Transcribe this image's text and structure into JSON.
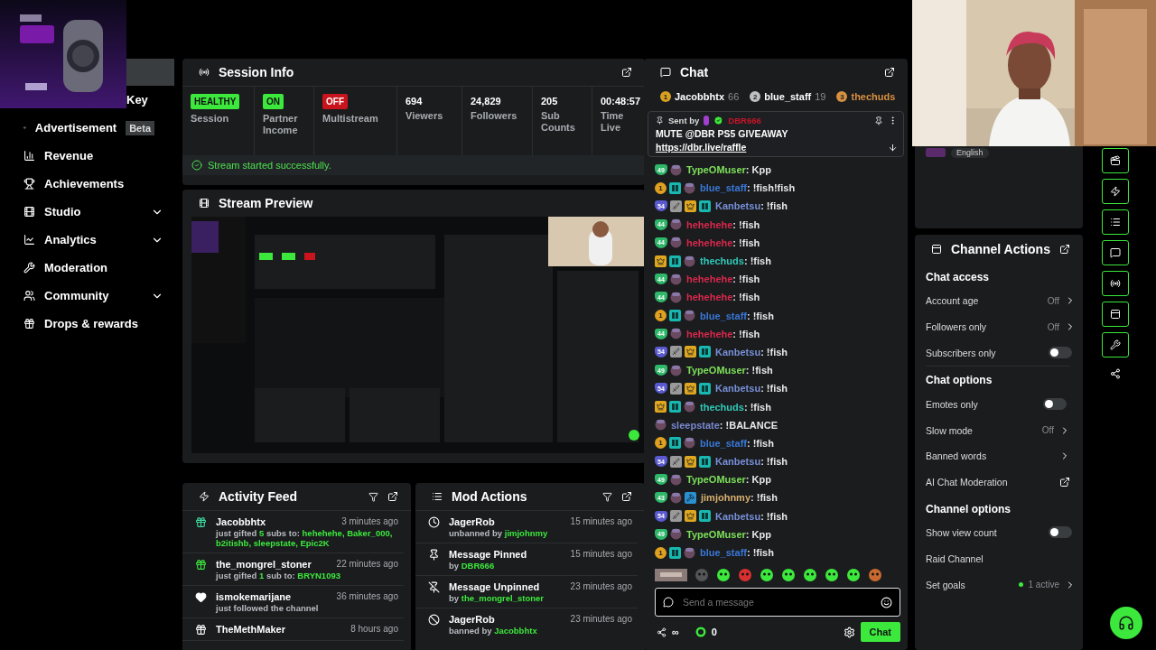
{
  "sidebar": {
    "items": [
      {
        "label": "Key",
        "kind": "partial"
      },
      {
        "label": "Advertisement",
        "badge": "Beta",
        "expandable": false
      },
      {
        "label": "Revenue",
        "expandable": false
      },
      {
        "label": "Achievements",
        "expandable": false
      },
      {
        "label": "Studio",
        "expandable": true
      },
      {
        "label": "Analytics",
        "expandable": true
      },
      {
        "label": "Moderation",
        "expandable": false
      },
      {
        "label": "Community",
        "expandable": true
      },
      {
        "label": "Drops & rewards",
        "expandable": false
      }
    ]
  },
  "session_info": {
    "title": "Session Info",
    "stats": [
      {
        "kind": "status",
        "pill": "HEALTHY",
        "color": "#3de83d",
        "label": "Session"
      },
      {
        "kind": "status",
        "pill": "ON",
        "color": "#3de83d",
        "label": "Partner Income"
      },
      {
        "kind": "status",
        "pill": "OFF",
        "color": "#c8141c",
        "label": "Multistream"
      },
      {
        "kind": "metric",
        "value": "694",
        "label": "Viewers"
      },
      {
        "kind": "metric",
        "value": "24,829",
        "label": "Followers"
      },
      {
        "kind": "metric",
        "value": "205",
        "label": "Sub Counts"
      },
      {
        "kind": "metric",
        "value": "00:48:57",
        "label": "Time Live"
      }
    ],
    "notice": "Stream started successfully."
  },
  "stream_preview": {
    "title": "Stream Preview"
  },
  "activity_feed": {
    "title": "Activity Feed",
    "items": [
      {
        "kind": "gift",
        "color": "#3ddca0",
        "name": "Jacobbhtx",
        "time": "3 minutes ago",
        "detail": "just gifted **5** subs to: **hehehehe, Baker_000, b2itishb, sleepstate, Epic2K**"
      },
      {
        "kind": "gift",
        "color": "#3de83d",
        "name": "the_mongrel_stoner",
        "time": "22 minutes ago",
        "detail": "just gifted **1** sub to: **BRYN1093**"
      },
      {
        "kind": "follow",
        "color": "#ffffff",
        "name": "ismokemarijane",
        "time": "36 minutes ago",
        "detail": "just followed the channel"
      },
      {
        "kind": "gift",
        "color": "#ffffff",
        "name": "TheMethMaker",
        "time": "8 hours ago"
      }
    ]
  },
  "mod_actions": {
    "title": "Mod Actions",
    "items": [
      {
        "kind": "unban",
        "title": "JagerRob",
        "time": "15 minutes ago",
        "detail": "unbanned by **jimjohnmy**"
      },
      {
        "kind": "pin",
        "title": "Message Pinned",
        "time": "15 minutes ago",
        "detail": "by **DBR666**"
      },
      {
        "kind": "unpin",
        "title": "Message Unpinned",
        "time": "23 minutes ago",
        "detail": "by **the_mongrel_stoner**"
      },
      {
        "kind": "ban",
        "title": "JagerRob",
        "time": "23 minutes ago",
        "detail": "banned by **Jacobbhtx**"
      }
    ]
  },
  "chat": {
    "title": "Chat",
    "leaderboard": [
      {
        "rank": "1",
        "name": "Jacobbhtx",
        "count": "66",
        "color": "#d8a020"
      },
      {
        "rank": "2",
        "name": "blue_staff",
        "count": "19",
        "color": "#c0c0c0"
      },
      {
        "rank": "3",
        "name": "thechuds",
        "color": "#d89040"
      }
    ],
    "pinned": {
      "label": "Sent by",
      "author": "DBR666",
      "text": "MUTE @DBR PS5 GIVEAWAY",
      "link": "https://dbr.live/raffle"
    },
    "messages": [
      {
        "name": "TypeOMuser",
        "color": "#7ee05a",
        "text": ": Kpp",
        "badges": [
          {
            "kind": "level",
            "text": "49"
          },
          {
            "kind": "avatar"
          }
        ]
      },
      {
        "name": "blue_staff",
        "color": "#3a78d8",
        "text": ": !fish!fish",
        "badges": [
          {
            "kind": "rank",
            "text": "1"
          },
          {
            "kind": "gg"
          },
          {
            "kind": "avatar"
          }
        ]
      },
      {
        "name": "Kanbetsu",
        "color": "#7890d8",
        "text": ": !fish",
        "badges": [
          {
            "kind": "tier",
            "text": "54"
          },
          {
            "kind": "sword"
          },
          {
            "kind": "crown"
          },
          {
            "kind": "gg"
          }
        ]
      },
      {
        "name": "hehehehe",
        "color": "#d8284c",
        "text": ": !fish",
        "badges": [
          {
            "kind": "level",
            "text": "44"
          },
          {
            "kind": "avatar"
          }
        ]
      },
      {
        "name": "hehehehe",
        "color": "#d8284c",
        "text": ": !fish",
        "badges": [
          {
            "kind": "level",
            "text": "44"
          },
          {
            "kind": "avatar"
          }
        ]
      },
      {
        "name": "thechuds",
        "color": "#30c8b8",
        "text": ": !fish",
        "badges": [
          {
            "kind": "crown"
          },
          {
            "kind": "gg"
          },
          {
            "kind": "avatar"
          }
        ]
      },
      {
        "name": "hehehehe",
        "color": "#d8284c",
        "text": ": !fish",
        "badges": [
          {
            "kind": "level",
            "text": "44"
          },
          {
            "kind": "avatar"
          }
        ]
      },
      {
        "name": "hehehehe",
        "color": "#d8284c",
        "text": ": !fish",
        "badges": [
          {
            "kind": "level",
            "text": "44"
          },
          {
            "kind": "avatar"
          }
        ]
      },
      {
        "name": "blue_staff",
        "color": "#3a78d8",
        "text": ": !fish",
        "badges": [
          {
            "kind": "rank",
            "text": "1"
          },
          {
            "kind": "gg"
          },
          {
            "kind": "avatar"
          }
        ]
      },
      {
        "name": "hehehehe",
        "color": "#d8284c",
        "text": ": !fish",
        "badges": [
          {
            "kind": "level",
            "text": "44"
          },
          {
            "kind": "avatar"
          }
        ]
      },
      {
        "name": "Kanbetsu",
        "color": "#7890d8",
        "text": ": !fish",
        "badges": [
          {
            "kind": "tier",
            "text": "54"
          },
          {
            "kind": "sword"
          },
          {
            "kind": "crown"
          },
          {
            "kind": "gg"
          }
        ]
      },
      {
        "name": "TypeOMuser",
        "color": "#7ee05a",
        "text": ": !fish",
        "badges": [
          {
            "kind": "level",
            "text": "49"
          },
          {
            "kind": "avatar"
          }
        ]
      },
      {
        "name": "Kanbetsu",
        "color": "#7890d8",
        "text": ": !fish",
        "badges": [
          {
            "kind": "tier",
            "text": "54"
          },
          {
            "kind": "sword"
          },
          {
            "kind": "crown"
          },
          {
            "kind": "gg"
          }
        ]
      },
      {
        "name": "thechuds",
        "color": "#30c8b8",
        "text": ": !fish",
        "badges": [
          {
            "kind": "crown"
          },
          {
            "kind": "gg"
          },
          {
            "kind": "avatar"
          }
        ]
      },
      {
        "name": "sleepstate",
        "color": "#7a8ad0",
        "text": ": !BALANCE",
        "badges": [
          {
            "kind": "avatar"
          }
        ]
      },
      {
        "name": "blue_staff",
        "color": "#3a78d8",
        "text": ": !fish",
        "badges": [
          {
            "kind": "rank",
            "text": "1"
          },
          {
            "kind": "gg"
          },
          {
            "kind": "avatar"
          }
        ]
      },
      {
        "name": "Kanbetsu",
        "color": "#7890d8",
        "text": ": !fish",
        "badges": [
          {
            "kind": "tier",
            "text": "54"
          },
          {
            "kind": "sword"
          },
          {
            "kind": "crown"
          },
          {
            "kind": "gg"
          }
        ]
      },
      {
        "name": "TypeOMuser",
        "color": "#7ee05a",
        "text": ": Kpp",
        "badges": [
          {
            "kind": "level",
            "text": "49"
          },
          {
            "kind": "avatar"
          }
        ]
      },
      {
        "name": "jimjohnmy",
        "color": "#d8b070",
        "text": ": !fish",
        "badges": [
          {
            "kind": "level",
            "text": "43"
          },
          {
            "kind": "avatar"
          },
          {
            "kind": "hammer"
          }
        ]
      },
      {
        "name": "Kanbetsu",
        "color": "#7890d8",
        "text": ": !fish",
        "badges": [
          {
            "kind": "tier",
            "text": "54"
          },
          {
            "kind": "sword"
          },
          {
            "kind": "crown"
          },
          {
            "kind": "gg"
          }
        ]
      },
      {
        "name": "TypeOMuser",
        "color": "#7ee05a",
        "text": ": Kpp",
        "badges": [
          {
            "kind": "level",
            "text": "49"
          },
          {
            "kind": "avatar"
          }
        ]
      },
      {
        "name": "blue_staff",
        "color": "#3a78d8",
        "text": ": !fish",
        "badges": [
          {
            "kind": "rank",
            "text": "1"
          },
          {
            "kind": "gg"
          },
          {
            "kind": "avatar"
          }
        ]
      }
    ],
    "input": {
      "placeholder": "Send a message"
    },
    "footer": {
      "connections": "∞",
      "points": "0",
      "send": "Chat"
    }
  },
  "language": {
    "label": "English"
  },
  "channel_actions": {
    "title": "Channel Actions",
    "sections": [
      {
        "title": "Chat access",
        "rows": [
          {
            "kind": "value",
            "label": "Account age",
            "value": "Off"
          },
          {
            "kind": "value",
            "label": "Followers only",
            "value": "Off"
          },
          {
            "kind": "toggle",
            "label": "Subscribers only",
            "on": false
          }
        ]
      },
      {
        "title": "Chat options",
        "rows": [
          {
            "kind": "toggle",
            "label": "Emotes only",
            "on": false
          },
          {
            "kind": "value",
            "label": "Slow mode",
            "value": "Off"
          },
          {
            "kind": "arrow",
            "label": "Banned words"
          },
          {
            "kind": "external",
            "label": "AI Chat Moderation"
          }
        ]
      },
      {
        "title": "Channel options",
        "rows": [
          {
            "kind": "toggle",
            "label": "Show view count",
            "on": false
          },
          {
            "kind": "plain",
            "label": "Raid Channel"
          },
          {
            "kind": "goal",
            "label": "Set goals",
            "value": "1 active",
            "color": "#3de83d"
          }
        ]
      }
    ]
  }
}
